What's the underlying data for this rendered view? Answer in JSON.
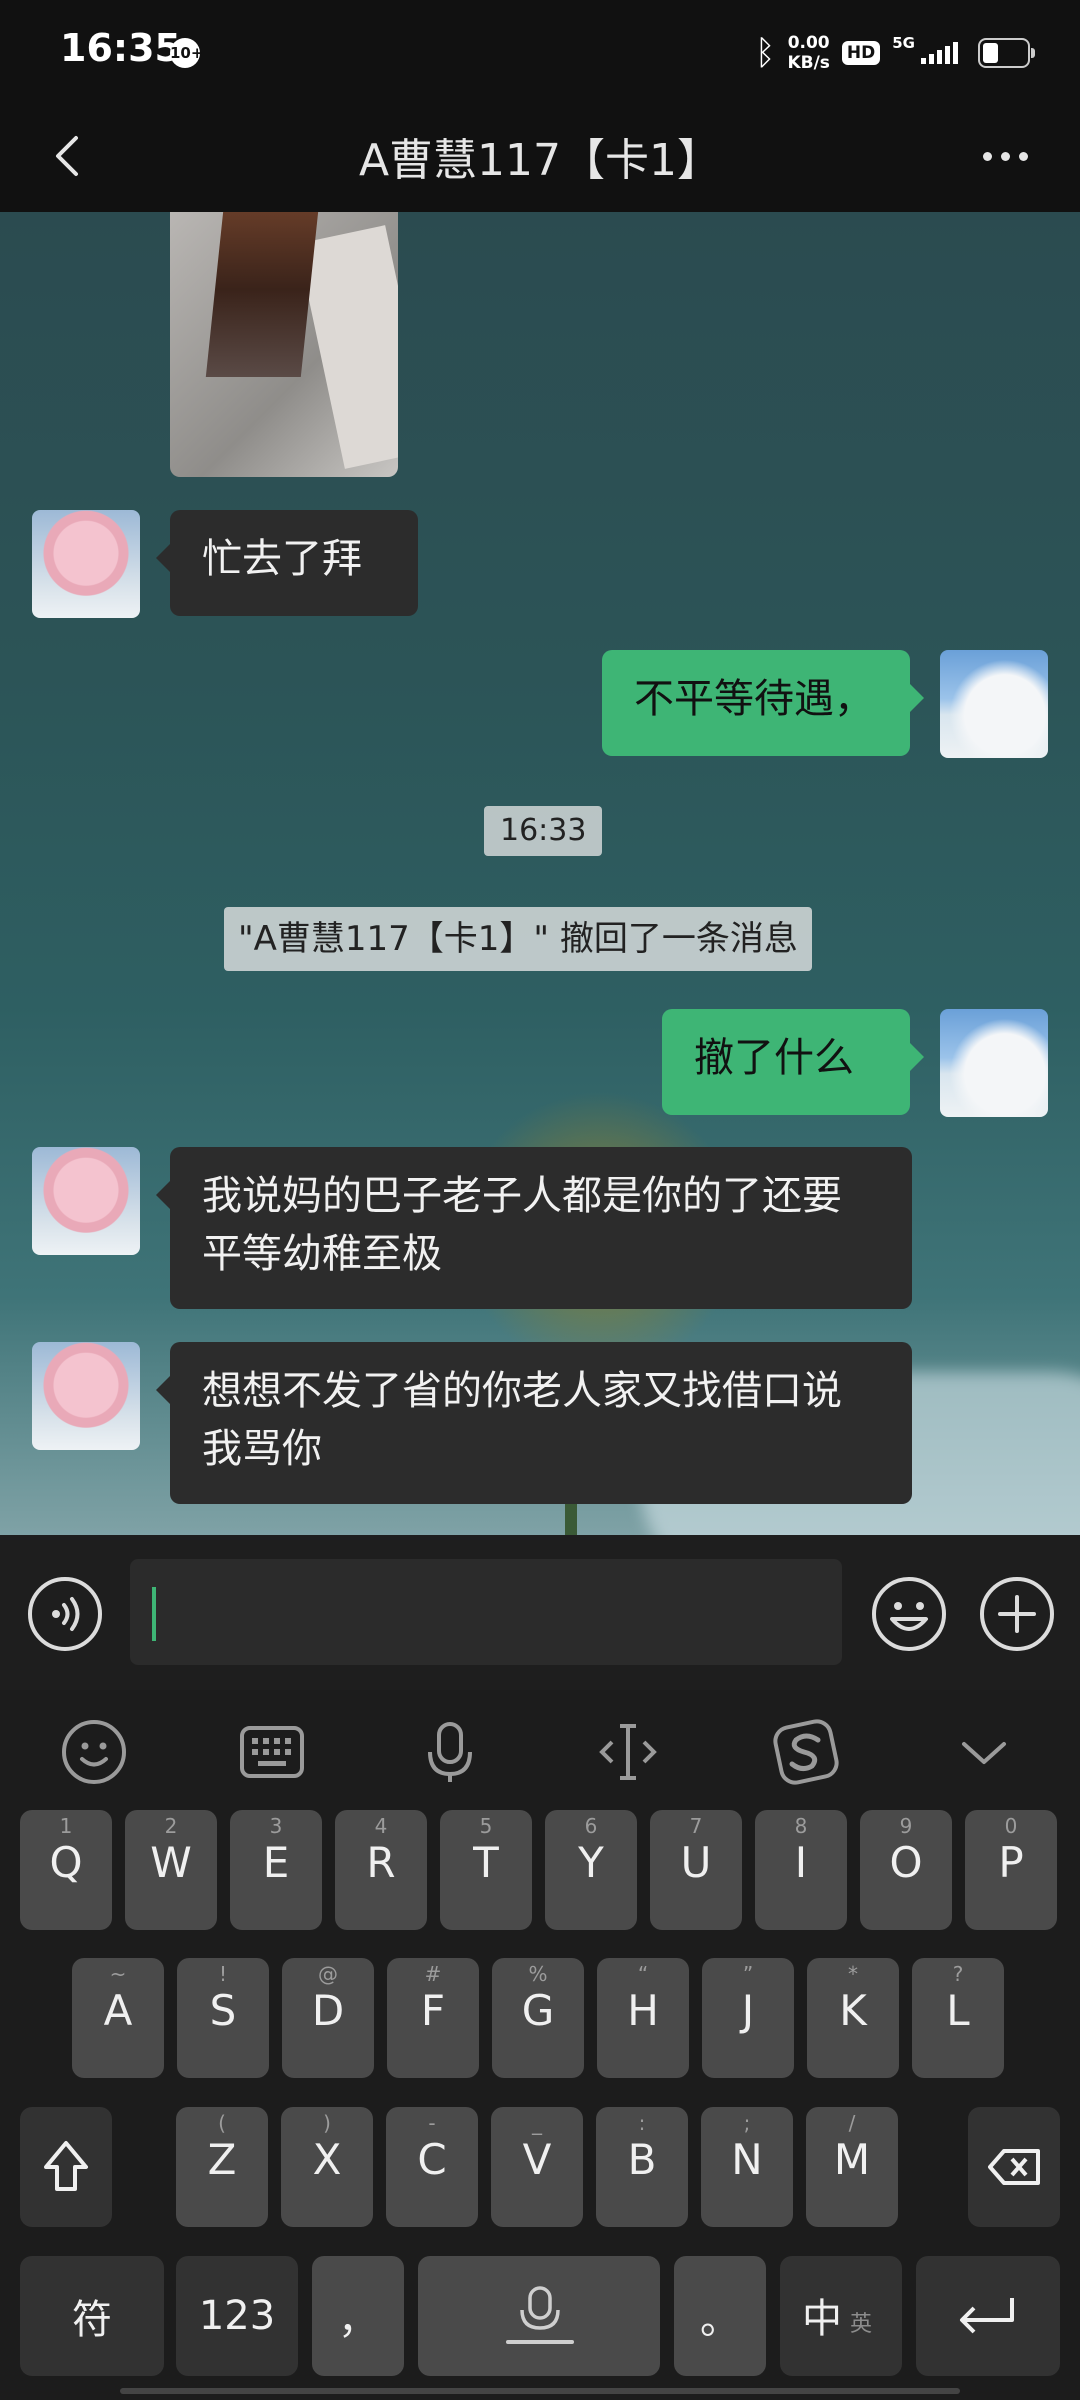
{
  "status_bar": {
    "time": "16:35",
    "notification_badge": "10+",
    "net_speed_value": "0.00",
    "net_speed_unit": "KB/s",
    "hd_label": "HD",
    "network_label": "5G",
    "battery_level": 0.35
  },
  "header": {
    "title": "A曹慧117【卡1】"
  },
  "chat": {
    "messages": [
      {
        "text": "忙去了拜"
      },
      {
        "text": "不平等待遇，"
      },
      {
        "time": "16:33"
      },
      {
        "system": "\"A曹慧117【卡1】\" 撤回了一条消息"
      },
      {
        "text": "撤了什么"
      },
      {
        "text": "我说妈的巴子老子人都是你的了还要平等幼稚至极"
      },
      {
        "text": "想想不发了省的你老人家又找借口说我骂你"
      }
    ]
  },
  "input": {
    "value": ""
  },
  "keyboard": {
    "rows": [
      [
        {
          "main": "Q",
          "hint": "1"
        },
        {
          "main": "W",
          "hint": "2"
        },
        {
          "main": "E",
          "hint": "3"
        },
        {
          "main": "R",
          "hint": "4"
        },
        {
          "main": "T",
          "hint": "5"
        },
        {
          "main": "Y",
          "hint": "6"
        },
        {
          "main": "U",
          "hint": "7"
        },
        {
          "main": "I",
          "hint": "8"
        },
        {
          "main": "O",
          "hint": "9"
        },
        {
          "main": "P",
          "hint": "0"
        }
      ],
      [
        {
          "main": "A",
          "hint": "~"
        },
        {
          "main": "S",
          "hint": "!"
        },
        {
          "main": "D",
          "hint": "@"
        },
        {
          "main": "F",
          "hint": "#"
        },
        {
          "main": "G",
          "hint": "%"
        },
        {
          "main": "H",
          "hint": "“"
        },
        {
          "main": "J",
          "hint": "”"
        },
        {
          "main": "K",
          "hint": "*"
        },
        {
          "main": "L",
          "hint": "?"
        }
      ],
      [
        {
          "main": "Z",
          "hint": "("
        },
        {
          "main": "X",
          "hint": ")"
        },
        {
          "main": "C",
          "hint": "-"
        },
        {
          "main": "V",
          "hint": "_"
        },
        {
          "main": "B",
          "hint": ":"
        },
        {
          "main": "N",
          "hint": ";"
        },
        {
          "main": "M",
          "hint": "/"
        }
      ]
    ],
    "symbol_key": "符",
    "number_key": "123",
    "comma_key": "，",
    "period_key": "。",
    "lang_key_main": "中",
    "lang_key_sub": "英"
  }
}
